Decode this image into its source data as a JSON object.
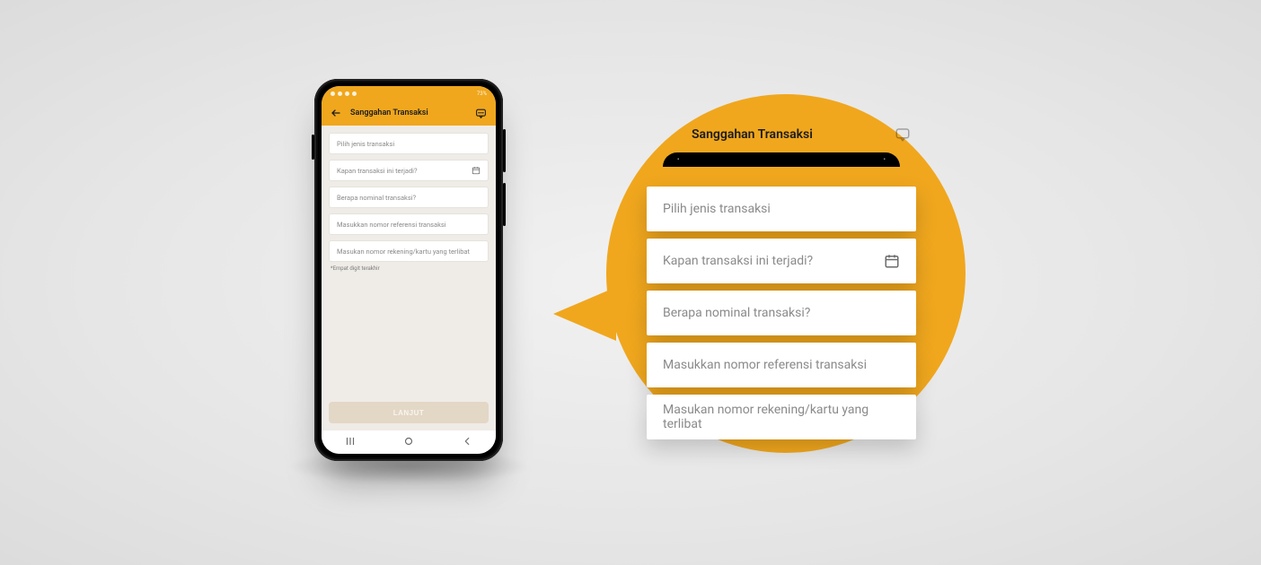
{
  "colors": {
    "accent": "#f0a71e",
    "button_disabled_bg": "#e3d7c6"
  },
  "status_bar": {
    "battery": "73%"
  },
  "app_bar": {
    "title": "Sanggahan Transaksi",
    "back_icon": "back-arrow",
    "action_icon": "chat-icon"
  },
  "form": {
    "fields": [
      {
        "key": "jenis",
        "placeholder": "Pilih jenis transaksi",
        "trailing_icon": null
      },
      {
        "key": "tanggal",
        "placeholder": "Kapan transaksi ini terjadi?",
        "trailing_icon": "calendar-icon"
      },
      {
        "key": "nominal",
        "placeholder": "Berapa nominal transaksi?",
        "trailing_icon": null
      },
      {
        "key": "ref",
        "placeholder": "Masukkan nomor referensi transaksi",
        "trailing_icon": null
      },
      {
        "key": "rekening",
        "placeholder": "Masukan nomor rekening/kartu yang terlibat",
        "trailing_icon": null
      }
    ],
    "helper_text": "*Empat digit terakhir"
  },
  "cta": {
    "label": "LANJUT"
  },
  "nav": {
    "recent": "recent-icon",
    "home": "home-icon",
    "back": "back-icon"
  },
  "callout": {
    "title": "Sanggahan Transaksi",
    "fields": [
      {
        "placeholder": "Pilih jenis transaksi",
        "trailing_icon": null
      },
      {
        "placeholder": "Kapan transaksi ini terjadi?",
        "trailing_icon": "calendar-icon"
      },
      {
        "placeholder": "Berapa nominal transaksi?",
        "trailing_icon": null
      },
      {
        "placeholder": "Masukkan nomor referensi transaksi",
        "trailing_icon": null
      },
      {
        "placeholder": "Masukan nomor rekening/kartu yang terlibat",
        "trailing_icon": null
      }
    ]
  }
}
